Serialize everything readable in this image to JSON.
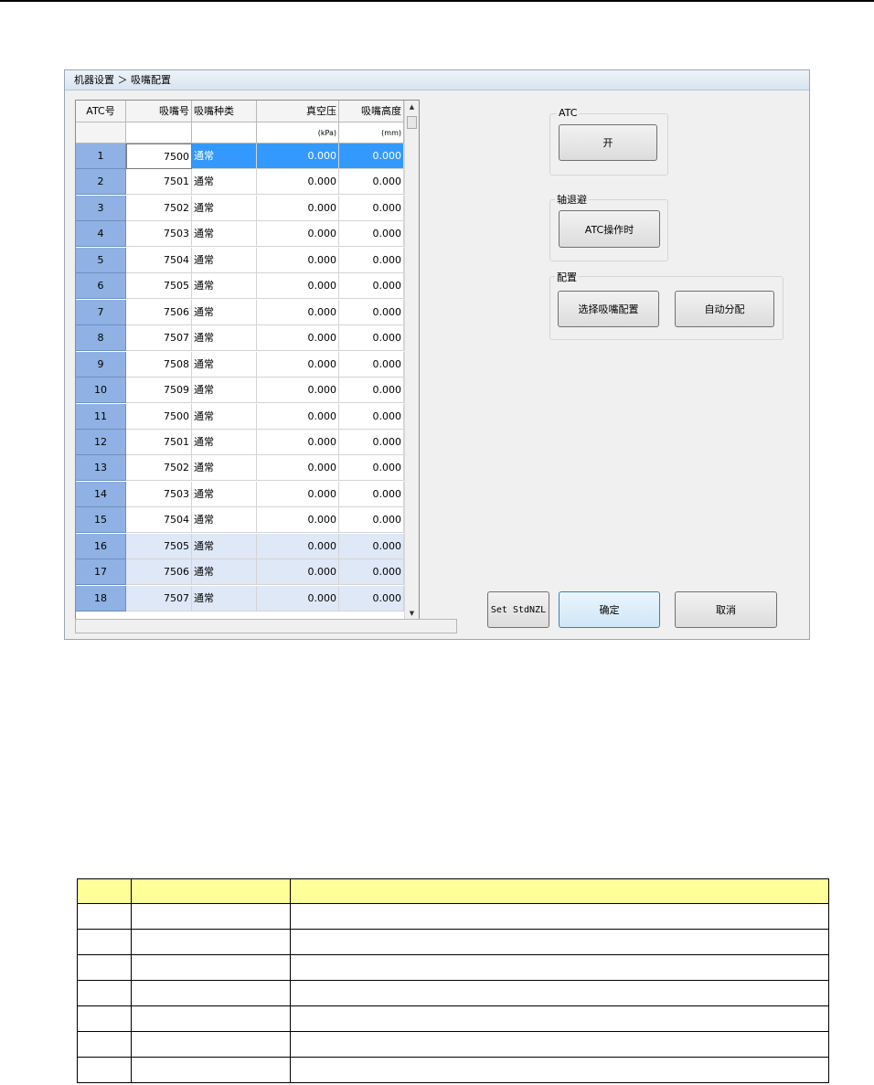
{
  "window": {
    "title": "机器设置 ＞ 吸嘴配置"
  },
  "grid": {
    "columns": [
      "ATC号",
      "吸嘴号",
      "吸嘴种类",
      "真空压",
      "吸嘴高度"
    ],
    "units": [
      "",
      "",
      "",
      "(kPa)",
      "(mm)"
    ],
    "rows": [
      {
        "atc": "1",
        "nozzle": "7500",
        "type": "通常",
        "vacuum": "0.000",
        "height": "0.000"
      },
      {
        "atc": "2",
        "nozzle": "7501",
        "type": "通常",
        "vacuum": "0.000",
        "height": "0.000"
      },
      {
        "atc": "3",
        "nozzle": "7502",
        "type": "通常",
        "vacuum": "0.000",
        "height": "0.000"
      },
      {
        "atc": "4",
        "nozzle": "7503",
        "type": "通常",
        "vacuum": "0.000",
        "height": "0.000"
      },
      {
        "atc": "5",
        "nozzle": "7504",
        "type": "通常",
        "vacuum": "0.000",
        "height": "0.000"
      },
      {
        "atc": "6",
        "nozzle": "7505",
        "type": "通常",
        "vacuum": "0.000",
        "height": "0.000"
      },
      {
        "atc": "7",
        "nozzle": "7506",
        "type": "通常",
        "vacuum": "0.000",
        "height": "0.000"
      },
      {
        "atc": "8",
        "nozzle": "7507",
        "type": "通常",
        "vacuum": "0.000",
        "height": "0.000"
      },
      {
        "atc": "9",
        "nozzle": "7508",
        "type": "通常",
        "vacuum": "0.000",
        "height": "0.000"
      },
      {
        "atc": "10",
        "nozzle": "7509",
        "type": "通常",
        "vacuum": "0.000",
        "height": "0.000"
      },
      {
        "atc": "11",
        "nozzle": "7500",
        "type": "通常",
        "vacuum": "0.000",
        "height": "0.000"
      },
      {
        "atc": "12",
        "nozzle": "7501",
        "type": "通常",
        "vacuum": "0.000",
        "height": "0.000"
      },
      {
        "atc": "13",
        "nozzle": "7502",
        "type": "通常",
        "vacuum": "0.000",
        "height": "0.000"
      },
      {
        "atc": "14",
        "nozzle": "7503",
        "type": "通常",
        "vacuum": "0.000",
        "height": "0.000"
      },
      {
        "atc": "15",
        "nozzle": "7504",
        "type": "通常",
        "vacuum": "0.000",
        "height": "0.000"
      },
      {
        "atc": "16",
        "nozzle": "7505",
        "type": "通常",
        "vacuum": "0.000",
        "height": "0.000"
      },
      {
        "atc": "17",
        "nozzle": "7506",
        "type": "通常",
        "vacuum": "0.000",
        "height": "0.000"
      },
      {
        "atc": "18",
        "nozzle": "7507",
        "type": "通常",
        "vacuum": "0.000",
        "height": "0.000"
      }
    ]
  },
  "atc_group": {
    "label": "ATC",
    "button": "开"
  },
  "axis_group": {
    "label": "轴退避",
    "button": "ATC操作时"
  },
  "config_group": {
    "label": "配置",
    "select_button": "选择吸嘴配置",
    "auto_button": "自动分配"
  },
  "footer": {
    "std_button": "Set StdNZL",
    "ok_button": "确定",
    "cancel_button": "取消"
  },
  "icons": {
    "scroll_up": "scroll-up-arrow-icon",
    "scroll_down": "scroll-down-arrow-icon"
  },
  "colors": {
    "selection": "#3399ff",
    "atc_cell": "#8fb1e3",
    "row_highlight": "#dfe8f7",
    "legend_header": "#ffff99"
  }
}
